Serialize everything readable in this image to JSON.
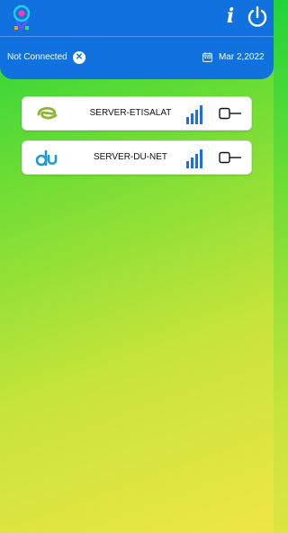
{
  "header": {
    "status": "Not Connected",
    "date": "Mar 2,2022",
    "info_label": "i"
  },
  "servers": [
    {
      "name": "SERVER-ETISALAT",
      "logo": "etisalat-logo",
      "signal": "4/4",
      "toggle": "off"
    },
    {
      "name": "SERVER-DU-NET",
      "logo": "du-logo",
      "signal": "4/4",
      "toggle": "off"
    }
  ],
  "colors": {
    "header_bg": "#1172df",
    "signal_blue": "#1e6fd9",
    "etisalat_green": "#8ab52e",
    "du_blue": "#1a9ad6",
    "gradient_top": "#1fd43a",
    "gradient_bottom": "#efe646"
  }
}
